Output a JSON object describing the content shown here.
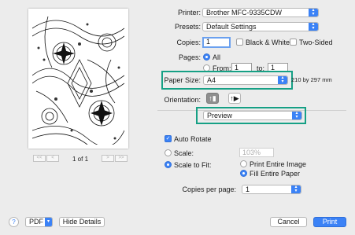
{
  "preview": {
    "page_indicator": "1 of 1",
    "nav": {
      "first": "<<",
      "prev": "<",
      "next": ">",
      "last": ">>"
    }
  },
  "printer": {
    "label": "Printer:",
    "value": "Brother MFC-9335CDW"
  },
  "presets": {
    "label": "Presets:",
    "value": "Default Settings"
  },
  "copies": {
    "label": "Copies:",
    "value": "1",
    "bw_label": "Black & White",
    "two_sided_label": "Two-Sided"
  },
  "pages": {
    "label": "Pages:",
    "all_label": "All",
    "from_label": "From:",
    "from_value": "1",
    "to_label": "to:",
    "to_value": "1"
  },
  "paper_size": {
    "label": "Paper Size:",
    "value": "A4",
    "dimensions": "210 by 297 mm"
  },
  "orientation": {
    "label": "Orientation:",
    "portrait_glyph": "↑▮",
    "landscape_glyph": "↑▶"
  },
  "panel_menu": {
    "value": "Preview"
  },
  "auto_rotate": {
    "label": "Auto Rotate",
    "checked": true
  },
  "scale": {
    "label": "Scale:",
    "value": "103%"
  },
  "scale_to_fit": {
    "label": "Scale to Fit:",
    "option1": "Print Entire Image",
    "option2": "Fill Entire Paper"
  },
  "copies_per_page": {
    "label": "Copies per page:",
    "value": "1"
  },
  "footer": {
    "help": "?",
    "pdf_label": "PDF",
    "hide_details": "Hide Details",
    "cancel": "Cancel",
    "print": "Print"
  },
  "colors": {
    "accent": "#3b82f6",
    "highlight": "#16a085"
  }
}
